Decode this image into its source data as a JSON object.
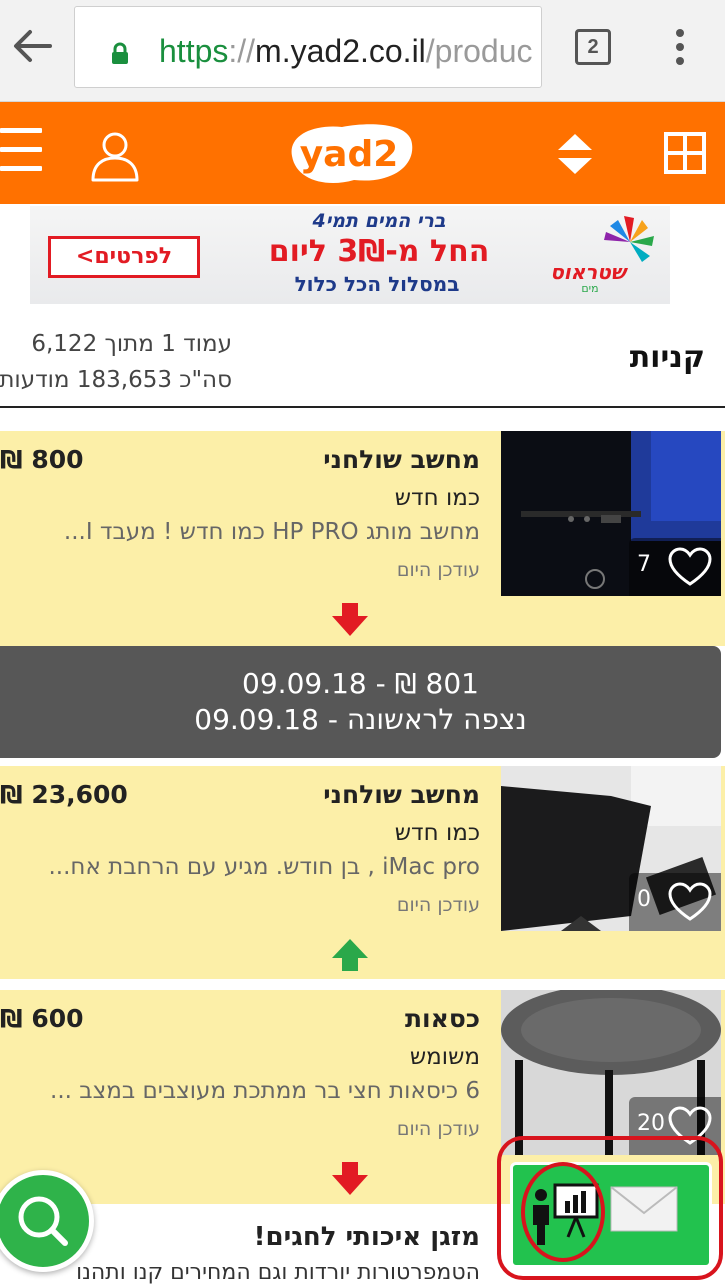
{
  "browser": {
    "url_scheme": "https",
    "url_sep": "://",
    "url_host": "m.yad2.co.il",
    "url_path": "/produc",
    "tab_count": "2"
  },
  "header": {
    "logo_text": "yad2",
    "icons": [
      "hamburger-icon",
      "user-icon",
      "sort-icon",
      "grid-icon"
    ],
    "brand_color": "#ff7100"
  },
  "banner": {
    "cta": "לפרטים>",
    "line1": "ברי המים תמי4",
    "line2": "החל מ-3₪ ליום",
    "line3": "במסלול הכל כלול",
    "brand": "שטראוס",
    "brand_sub": "מים"
  },
  "results": {
    "category": "קניות",
    "page_info_1": "עמוד 1 מתוך 6,122",
    "page_info_2": "סה\"כ 183,653 מודעות"
  },
  "listings": [
    {
      "title": "מחשב שולחני",
      "price": "800 ₪",
      "condition": "כמו חדש",
      "description": "מחשב מותג HP PRO כמו חדש ! מעבד I...",
      "updated": "עודכן היום",
      "likes": "7",
      "trend": "down"
    },
    {
      "title": "מחשב שולחני",
      "price": "23,600 ₪",
      "condition": "כמו חדש",
      "description": "iMac pro , בן חודש. מגיע עם הרחבת אח...",
      "updated": "עודכן היום",
      "likes": "0",
      "trend": "up"
    },
    {
      "title": "כסאות",
      "price": "600 ₪",
      "condition": "משומש",
      "description": "6 כיסאות חצי בר ממתכת מעוצבים במצב ...",
      "updated": "עודכן היום",
      "likes": "20",
      "trend": "down"
    }
  ],
  "price_history": {
    "line1": "801 ₪ - 09.09.18",
    "line2": "נצפה לראשונה - 09.09.18"
  },
  "promo": {
    "title": "מזגן איכותי לחגים!",
    "text": "הטמפרטורות יורדות וגם המחירים קנו ותהנו"
  },
  "colors": {
    "listing_bg": "#fcefa8",
    "down_arrow": "#e21b23",
    "up_arrow": "#2aa84a",
    "fab_green": "#22c24e"
  }
}
